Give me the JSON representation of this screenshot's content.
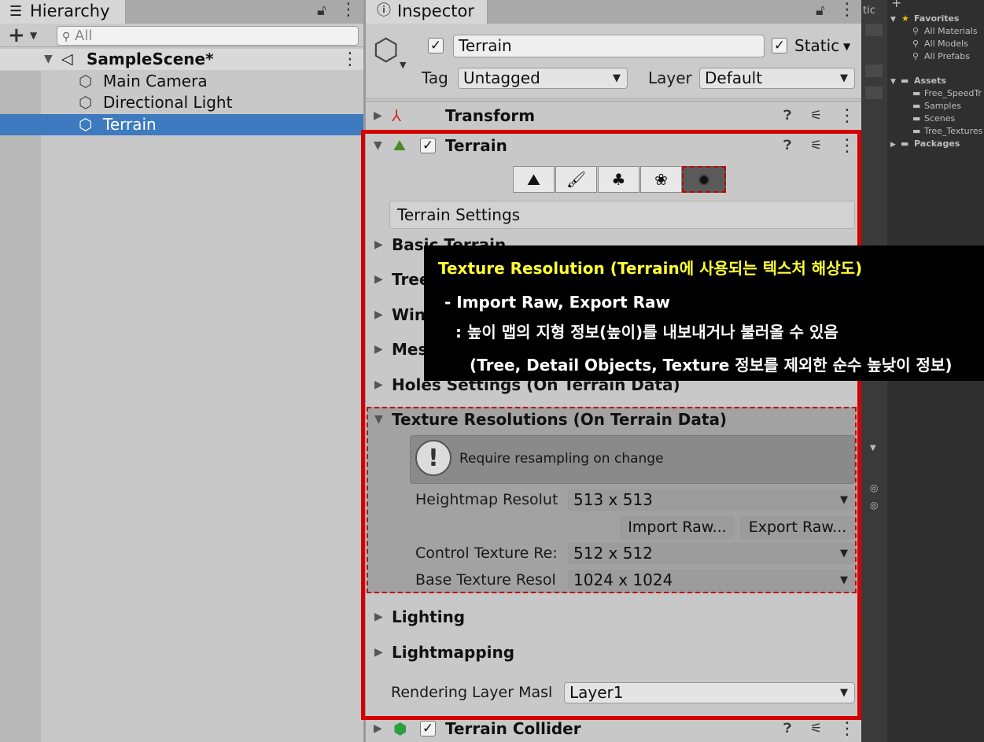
{
  "hierarchy": {
    "tab_title": "Hierarchy",
    "add_label": "+",
    "search_placeholder": "All",
    "scene": "SampleScene*",
    "items": [
      "Main Camera",
      "Directional Light",
      "Terrain"
    ]
  },
  "inspector": {
    "tab_title": "Inspector",
    "object_name": "Terrain",
    "static_label": "Static",
    "tag_label": "Tag",
    "tag_value": "Untagged",
    "layer_label": "Layer",
    "layer_value": "Default",
    "components": {
      "transform": "Transform",
      "terrain": "Terrain",
      "terrain_collider": "Terrain Collider"
    },
    "settings_header": "Terrain Settings",
    "sections": {
      "basic_terrain": "Basic Terrain",
      "tree": "Tree",
      "wind": "Wind",
      "mesh": "Mes",
      "holes": "Holes Settings (On Terrain Data)",
      "texture_res": "Texture Resolutions (On Terrain Data)",
      "lighting": "Lighting",
      "lightmapping": "Lightmapping"
    },
    "warning": "Require resampling on change",
    "heightmap_label": "Heightmap Resolut",
    "heightmap_value": "513 x 513",
    "import_button": "Import Raw...",
    "export_button": "Export Raw...",
    "control_label": "Control Texture Re:",
    "control_value": "512 x 512",
    "base_label": "Base Texture Resol",
    "base_value": "1024 x 1024",
    "rendering_label": "Rendering Layer Masl",
    "rendering_value": "Layer1"
  },
  "project": {
    "favorites": "Favorites",
    "fav_items": [
      "All Materials",
      "All Models",
      "All Prefabs"
    ],
    "assets": "Assets",
    "asset_items": [
      "Free_SpeedTr",
      "Samples",
      "Scenes",
      "Tree_Textures"
    ],
    "packages": "Packages",
    "cutoff_tab": "tic"
  },
  "tooltip": {
    "title": "Texture Resolution (Terrain에 사용되는 텍스처 해상도)",
    "line1": "- Import Raw, Export Raw",
    "line2": ": 높이 맵의 지형 정보(높이)를 내보내거나 불러올 수 있음",
    "line3": "(Tree, Detail Objects, Texture 정보를 제외한 순수 높낮이 정보)"
  },
  "colors": {
    "selection": "#3d7ac0",
    "highlight_box": "#d40000",
    "tooltip_title": "#ffff33"
  }
}
